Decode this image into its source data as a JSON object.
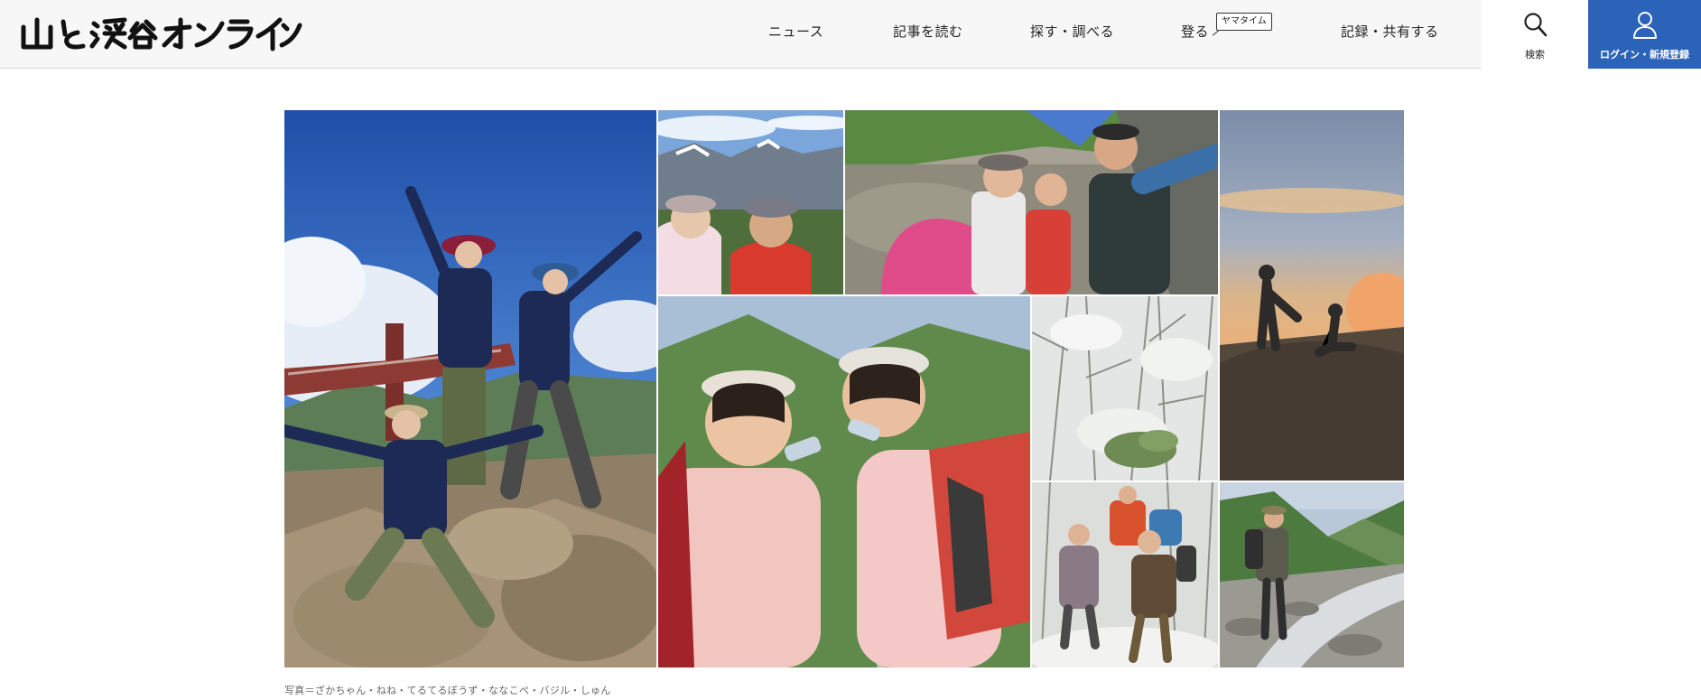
{
  "header": {
    "logo_text": "山と溪谷オンライン",
    "nav": [
      {
        "label": "ニュース"
      },
      {
        "label": "記事を読む"
      },
      {
        "label": "探す・調べる"
      },
      {
        "label": "登る"
      },
      {
        "label": "記録・共有する"
      }
    ],
    "climb_badge": "ヤマタイム",
    "search_label": "検索",
    "login_label": "ログイン・新規登録"
  },
  "main": {
    "photos": [
      {
        "icon": "group-summit-photo"
      },
      {
        "icon": "couple-selfie-photo"
      },
      {
        "icon": "family-selfie-photo"
      },
      {
        "icon": "sunset-silhouette-photo"
      },
      {
        "icon": "children-drinking-photo"
      },
      {
        "icon": "snowy-forest-photo"
      },
      {
        "icon": "snow-group-photo"
      },
      {
        "icon": "valley-hiker-photo"
      }
    ],
    "caption": "写真＝ざかちゃん・ねね・てるてるぼうず・ななこぺ・バジル・しゅん"
  },
  "colors": {
    "header_bg": "#f7f7f7",
    "login_bg": "#2b63b8",
    "text": "#222222",
    "caption": "#666666"
  }
}
